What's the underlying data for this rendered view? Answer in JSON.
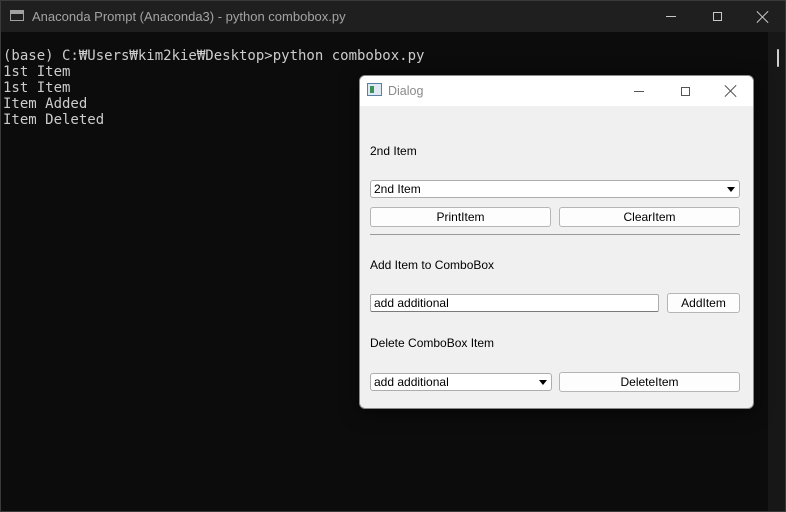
{
  "console": {
    "title": "Anaconda Prompt (Anaconda3) - python  combobox.py",
    "lines": [
      "(base) C:₩Users₩kim2kie₩Desktop>python combobox.py",
      "1st Item",
      "1st Item",
      "Item Added",
      "Item Deleted"
    ]
  },
  "dialog": {
    "title": "Dialog",
    "selected_label": "2nd Item",
    "combo_value": "2nd Item",
    "print_button": "PrintItem",
    "clear_button": "ClearItem",
    "add_label": "Add Item to ComboBox",
    "add_input_value": "add additional",
    "add_button": "AddItem",
    "delete_label": "Delete ComboBox Item",
    "delete_combo_value": "add additional",
    "delete_button": "DeleteItem"
  },
  "colors": {
    "console_bg": "#0c0c0c",
    "console_text": "#cccccc",
    "dialog_bg": "#f0f0f0"
  }
}
